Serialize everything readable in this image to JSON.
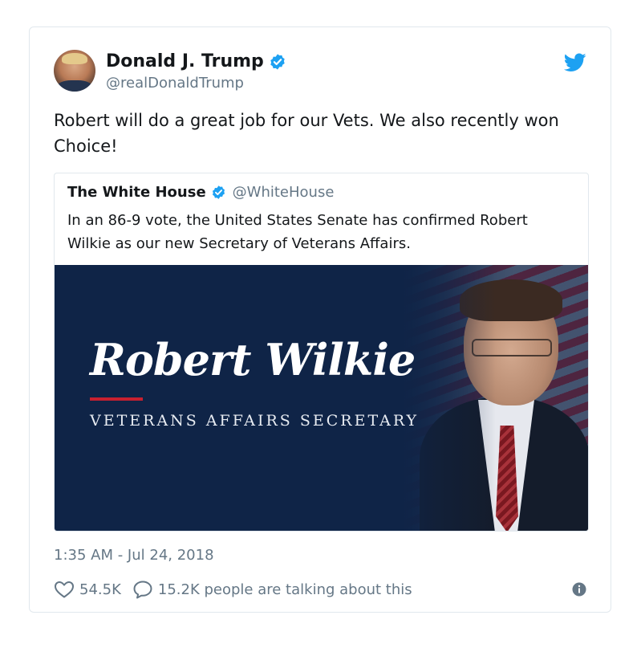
{
  "tweet": {
    "author_name": "Donald J. Trump",
    "author_handle": "@realDonaldTrump",
    "text": "Robert will do a great job for our Vets. We also recently won Choice!",
    "timestamp": "1:35 AM - Jul 24, 2018",
    "likes": "54.5K",
    "replies": "15.2K people are talking about this",
    "icons": {
      "avatar": "avatar",
      "verified": "verified-badge-icon",
      "brand": "twitter-bird-icon",
      "like": "heart-icon",
      "reply": "speech-bubble-icon",
      "info": "info-icon"
    }
  },
  "quoted": {
    "author_name": "The White House",
    "author_handle": "@WhiteHouse",
    "text": "In an 86-9 vote, the United States Senate has confirmed Robert Wilkie as our new Secretary of Veterans Affairs.",
    "image": {
      "title": "Robert Wilkie",
      "subtitle": "VETERANS AFFAIRS SECRETARY"
    }
  },
  "colors": {
    "twitter_blue": "#1da1f2",
    "muted_text": "#657786",
    "primary_text": "#14171a",
    "border": "#e1e8ed",
    "image_navy": "#0f2447",
    "accent_red": "#c8202f"
  }
}
